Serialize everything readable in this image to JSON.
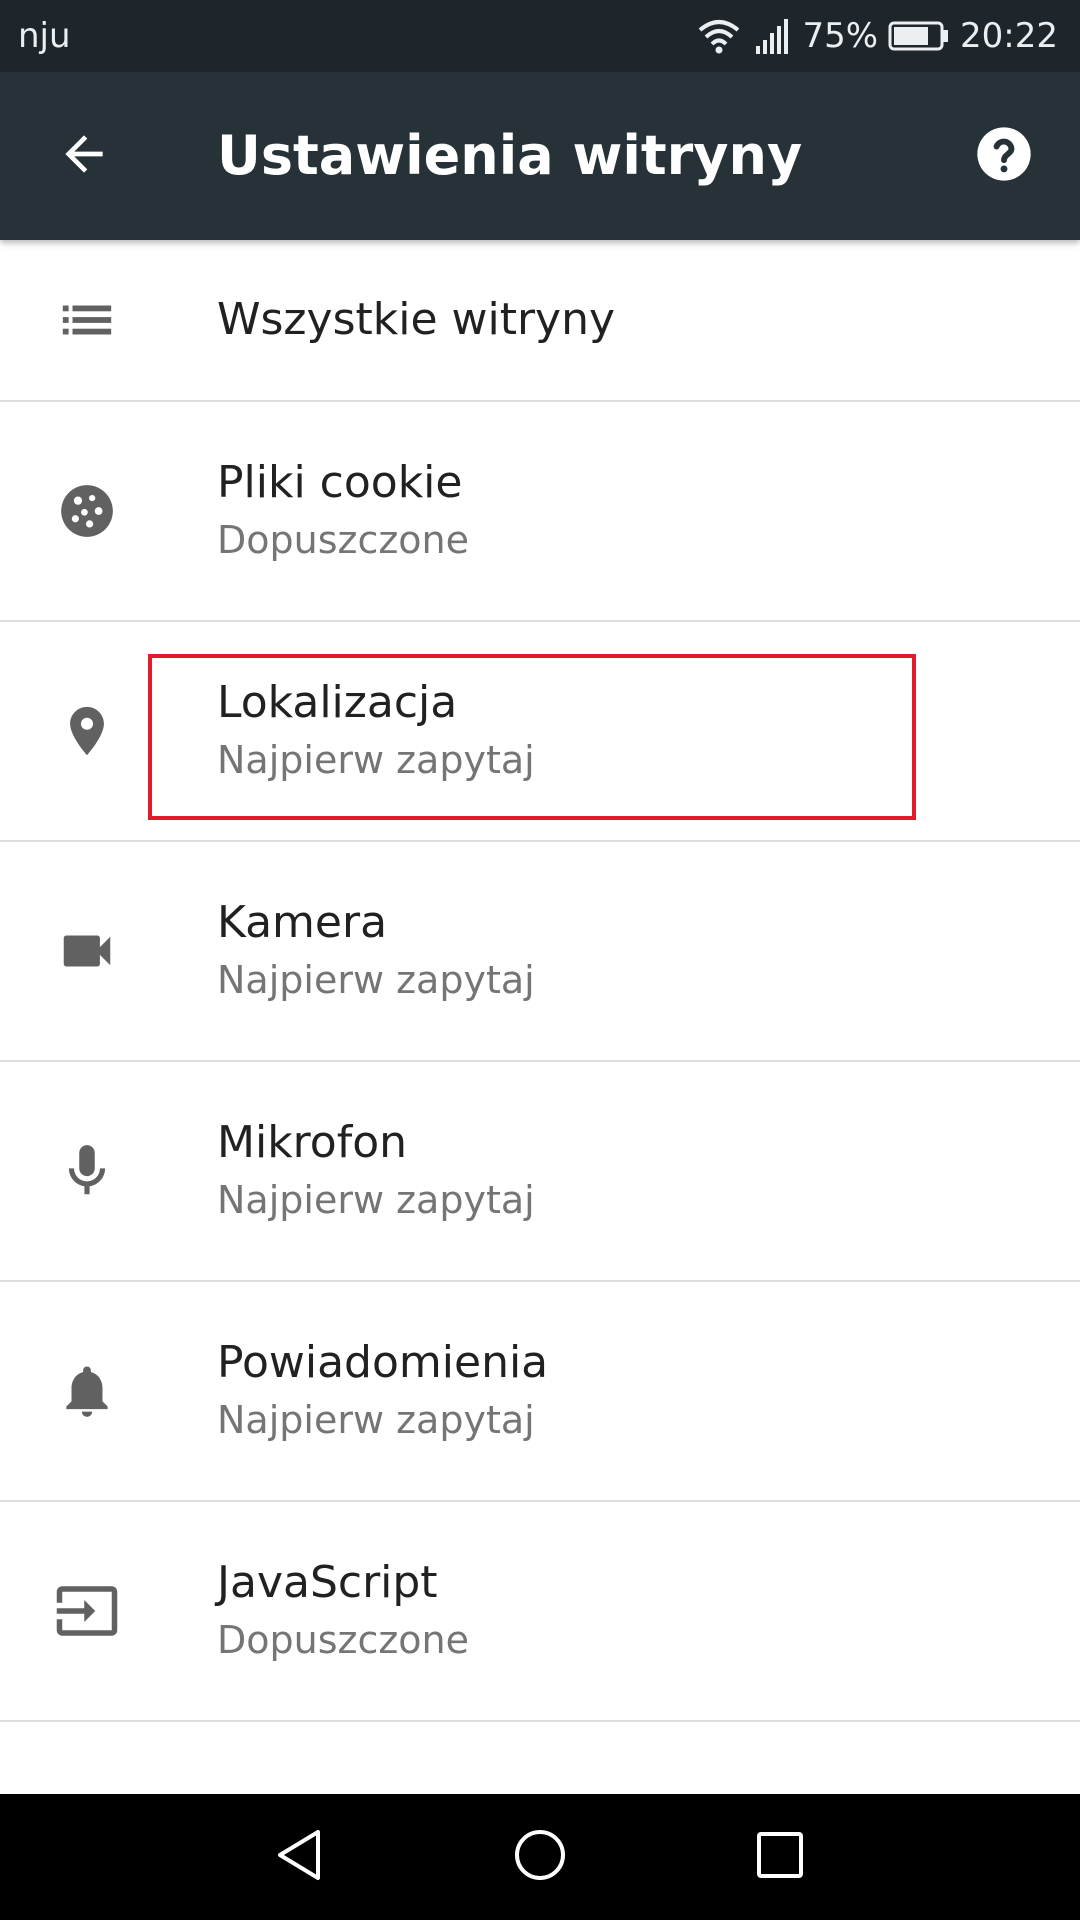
{
  "status_bar": {
    "carrier": "nju",
    "battery_percent": "75%",
    "time": "20:22",
    "icons": [
      "wifi-icon",
      "signal-icon",
      "battery-icon"
    ]
  },
  "app_bar": {
    "title": "Ustawienia witryny",
    "back_icon": "arrow-back-icon",
    "help_icon": "help-icon"
  },
  "settings": {
    "all_sites": {
      "title": "Wszystkie witryny",
      "icon": "list-icon"
    },
    "items": [
      {
        "title": "Pliki cookie",
        "summary": "Dopuszczone",
        "icon": "cookie-icon"
      },
      {
        "title": "Lokalizacja",
        "summary": "Najpierw zapytaj",
        "icon": "location-pin-icon"
      },
      {
        "title": "Kamera",
        "summary": "Najpierw zapytaj",
        "icon": "videocam-icon"
      },
      {
        "title": "Mikrofon",
        "summary": "Najpierw zapytaj",
        "icon": "microphone-icon"
      },
      {
        "title": "Powiadomienia",
        "summary": "Najpierw zapytaj",
        "icon": "bell-icon"
      },
      {
        "title": "JavaScript",
        "summary": "Dopuszczone",
        "icon": "input-icon"
      }
    ]
  },
  "colors": {
    "status_bar": "#1f262b",
    "app_bar": "#263238",
    "highlight": "#e11b2c",
    "icon_gray": "#616161",
    "summary_gray": "#757575"
  },
  "nav_bar": {
    "icons": [
      "back-triangle-icon",
      "home-circle-icon",
      "recents-square-icon"
    ]
  }
}
